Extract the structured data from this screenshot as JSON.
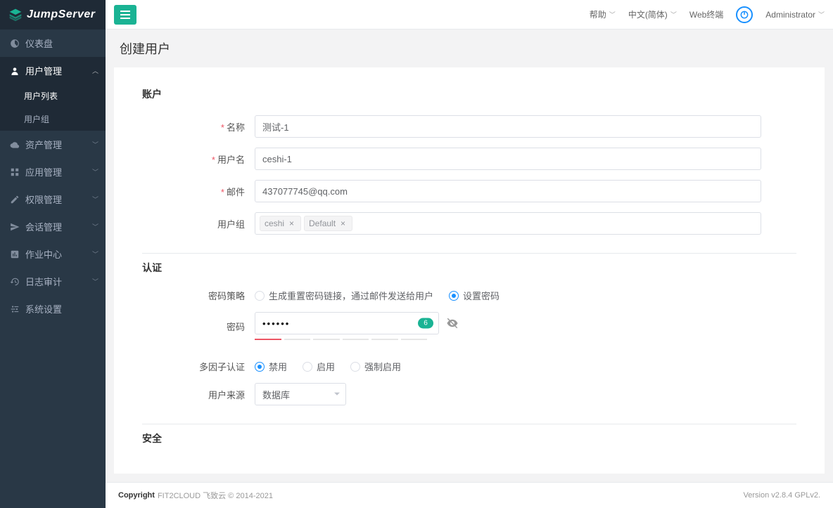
{
  "brand": "JumpServer",
  "header": {
    "help": "帮助",
    "lang": "中文(简体)",
    "terminal": "Web终端",
    "user": "Administrator"
  },
  "sidebar": {
    "items": [
      {
        "label": "仪表盘",
        "icon": "dashboard"
      },
      {
        "label": "用户管理",
        "icon": "user",
        "active": true,
        "expanded": true,
        "children": [
          {
            "label": "用户列表",
            "active": true
          },
          {
            "label": "用户组"
          }
        ]
      },
      {
        "label": "资产管理",
        "icon": "cloud"
      },
      {
        "label": "应用管理",
        "icon": "grid"
      },
      {
        "label": "权限管理",
        "icon": "edit"
      },
      {
        "label": "会话管理",
        "icon": "send"
      },
      {
        "label": "作业中心",
        "icon": "task"
      },
      {
        "label": "日志审计",
        "icon": "history"
      },
      {
        "label": "系统设置",
        "icon": "settings"
      }
    ]
  },
  "page": {
    "title": "创建用户"
  },
  "form": {
    "sections": {
      "account": "账户",
      "auth": "认证",
      "security": "安全"
    },
    "fields": {
      "name": {
        "label": "名称",
        "value": "测试-1"
      },
      "username": {
        "label": "用户名",
        "value": "ceshi-1"
      },
      "email": {
        "label": "邮件",
        "value": "437077745@qq.com"
      },
      "groups": {
        "label": "用户组",
        "tags": [
          "ceshi",
          "Default"
        ]
      },
      "pwd_policy": {
        "label": "密码策略",
        "options": [
          "生成重置密码链接，通过邮件发送给用户",
          "设置密码"
        ],
        "selected": 1
      },
      "password": {
        "label": "密码",
        "value": "••••••",
        "strength": "6"
      },
      "mfa": {
        "label": "多因子认证",
        "options": [
          "禁用",
          "启用",
          "强制启用"
        ],
        "selected": 0
      },
      "source": {
        "label": "用户来源",
        "value": "数据库"
      }
    }
  },
  "footer": {
    "copyright_label": "Copyright",
    "copyright_text": "FIT2CLOUD 飞致云 © 2014-2021",
    "version": "Version v2.8.4 GPLv2."
  }
}
